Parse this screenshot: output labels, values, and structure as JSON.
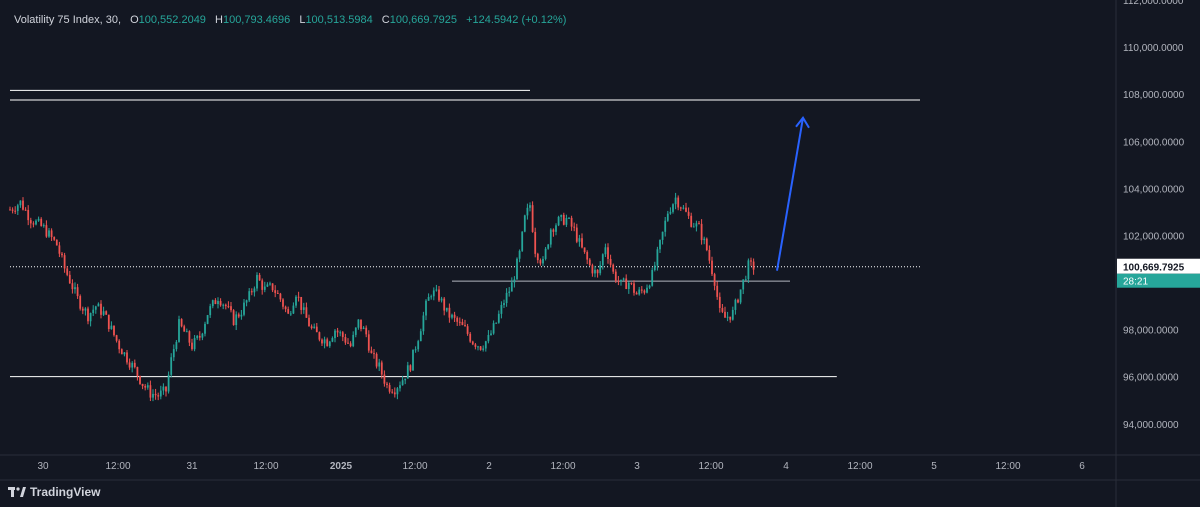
{
  "header": {
    "symbol": "Volatility 75 Index, 30,",
    "open_label": "O",
    "open": "100,552.2049",
    "high_label": "H",
    "high": "100,793.4696",
    "low_label": "L",
    "low": "100,513.5984",
    "close_label": "C",
    "close": "100,669.7925",
    "change": "+124.5942 (+0.12%)"
  },
  "branding": {
    "name": "TradingView"
  },
  "colors": {
    "background": "#131722",
    "up": "#26a69a",
    "down": "#ef5350",
    "arrow": "#2962ff",
    "price_tag": "#ffffff",
    "countdown_bg": "#26a69a"
  },
  "price_tag": {
    "price": "100,669.7925",
    "countdown": "28:21"
  },
  "chart_data": {
    "type": "candlestick",
    "ylim": [
      92800,
      112000
    ],
    "y_ticks": [
      "112,000.0000",
      "110,000.0000",
      "108,000.0000",
      "106,000.0000",
      "104,000.0000",
      "102,000.0000",
      "98,000.0000",
      "96,000.0000",
      "94,000.0000"
    ],
    "y_tick_values": [
      112000,
      110000,
      108000,
      106000,
      104000,
      102000,
      98000,
      96000,
      94000
    ],
    "x_ticks": [
      "30",
      "12:00",
      "31",
      "12:00",
      "2025",
      "12:00",
      "2",
      "12:00",
      "3",
      "12:00",
      "4",
      "12:00",
      "5",
      "12:00",
      "6"
    ],
    "x_tick_bold": [
      false,
      false,
      false,
      false,
      true,
      false,
      false,
      false,
      false,
      false,
      false,
      false,
      false,
      false,
      false
    ],
    "price_path": [
      [
        0,
        103100
      ],
      [
        4,
        103400
      ],
      [
        8,
        102700
      ],
      [
        13,
        102300
      ],
      [
        18,
        101600
      ],
      [
        21,
        100600
      ],
      [
        23,
        100100
      ],
      [
        26,
        99300
      ],
      [
        30,
        98600
      ],
      [
        33,
        99000
      ],
      [
        36,
        98700
      ],
      [
        39,
        98000
      ],
      [
        42,
        97300
      ],
      [
        45,
        96800
      ],
      [
        48,
        96300
      ],
      [
        51,
        95700
      ],
      [
        54,
        95300
      ],
      [
        57,
        95200
      ],
      [
        60,
        95400
      ],
      [
        62,
        96700
      ],
      [
        65,
        98200
      ],
      [
        67,
        97900
      ],
      [
        70,
        97300
      ],
      [
        73,
        97700
      ],
      [
        76,
        98700
      ],
      [
        80,
        99400
      ],
      [
        83,
        99000
      ],
      [
        86,
        98400
      ],
      [
        89,
        98800
      ],
      [
        92,
        99400
      ],
      [
        95,
        100200
      ],
      [
        98,
        99700
      ],
      [
        101,
        99800
      ],
      [
        104,
        99300
      ],
      [
        107,
        98600
      ],
      [
        110,
        99600
      ],
      [
        113,
        98700
      ],
      [
        116,
        98000
      ],
      [
        119,
        97700
      ],
      [
        122,
        97500
      ],
      [
        125,
        98000
      ],
      [
        128,
        97700
      ],
      [
        131,
        97300
      ],
      [
        134,
        98300
      ],
      [
        137,
        97800
      ],
      [
        139,
        96900
      ],
      [
        142,
        96400
      ],
      [
        145,
        95600
      ],
      [
        148,
        95500
      ],
      [
        151,
        95900
      ],
      [
        154,
        96500
      ],
      [
        157,
        97700
      ],
      [
        160,
        99000
      ],
      [
        162,
        99600
      ],
      [
        165,
        99400
      ],
      [
        168,
        98700
      ],
      [
        172,
        98300
      ],
      [
        175,
        98000
      ],
      [
        178,
        97500
      ],
      [
        181,
        97300
      ],
      [
        184,
        97600
      ],
      [
        187,
        98300
      ],
      [
        190,
        99200
      ],
      [
        193,
        99900
      ],
      [
        196,
        101200
      ],
      [
        198,
        102700
      ],
      [
        200,
        103300
      ],
      [
        202,
        101400
      ],
      [
        205,
        100800
      ],
      [
        208,
        102300
      ],
      [
        211,
        102600
      ],
      [
        214,
        102700
      ],
      [
        217,
        102200
      ],
      [
        220,
        101400
      ],
      [
        223,
        100700
      ],
      [
        226,
        100300
      ],
      [
        229,
        101600
      ],
      [
        232,
        100400
      ],
      [
        235,
        99900
      ],
      [
        238,
        100000
      ],
      [
        241,
        99500
      ],
      [
        244,
        99700
      ],
      [
        247,
        100300
      ],
      [
        250,
        101600
      ],
      [
        253,
        103000
      ],
      [
        256,
        103600
      ],
      [
        259,
        103100
      ],
      [
        262,
        102600
      ],
      [
        265,
        102300
      ],
      [
        268,
        101400
      ],
      [
        271,
        100100
      ],
      [
        273,
        98700
      ],
      [
        275,
        98500
      ],
      [
        278,
        98700
      ],
      [
        281,
        99700
      ],
      [
        284,
        100700
      ],
      [
        286,
        100670
      ]
    ]
  },
  "annotations": {
    "levels": [
      {
        "price": 108160,
        "from": 0,
        "to": 200
      },
      {
        "price": 107750,
        "from": 0,
        "to": 350
      },
      {
        "price": 100670,
        "from": 0,
        "to": 350
      },
      {
        "price": 100060,
        "from": 170,
        "to": 300
      },
      {
        "price": 96000,
        "from": 0,
        "to": 318
      }
    ],
    "arrow": {
      "from": [
        295,
        100500
      ],
      "to": [
        305,
        107000
      ]
    }
  }
}
